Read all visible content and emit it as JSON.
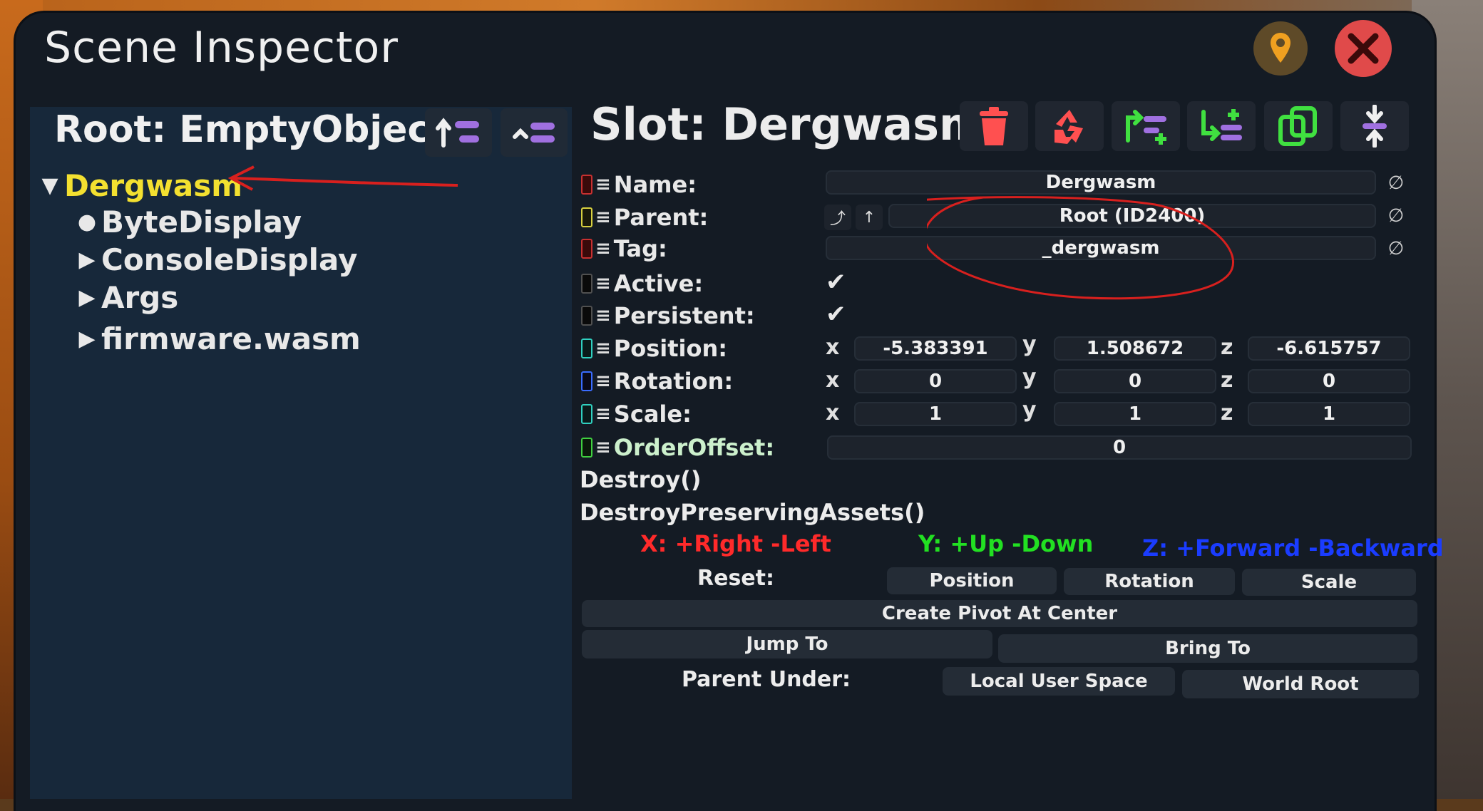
{
  "window": {
    "title": "Scene Inspector"
  },
  "hierarchy": {
    "root_label": "Root: EmptyObject",
    "items": [
      {
        "label": "Dergwasm",
        "expander": "▼",
        "selected": true
      },
      {
        "label": "ByteDisplay",
        "expander": "●"
      },
      {
        "label": "ConsoleDisplay",
        "expander": "▶"
      },
      {
        "label": "Args",
        "expander": "▶"
      },
      {
        "label": "firmware.wasm",
        "expander": "▶"
      }
    ]
  },
  "inspector": {
    "slot_title": "Slot: Dergwasm",
    "fields": {
      "name": {
        "label": "Name:",
        "value": "Dergwasm"
      },
      "parent": {
        "label": "Parent:",
        "value": "Root (ID2400)"
      },
      "tag": {
        "label": "Tag:",
        "value": "_dergwasm"
      },
      "active": {
        "label": "Active:",
        "checked": true
      },
      "persistent": {
        "label": "Persistent:",
        "checked": true
      },
      "position": {
        "label": "Position:",
        "x": "-5.383391",
        "y": "1.508672",
        "z": "-6.615757"
      },
      "rotation": {
        "label": "Rotation:",
        "x": "0",
        "y": "0",
        "z": "0"
      },
      "scale": {
        "label": "Scale:",
        "x": "1",
        "y": "1",
        "z": "1"
      },
      "order_offset": {
        "label": "OrderOffset:",
        "value": "0"
      }
    },
    "axis_letters": {
      "x": "x",
      "y": "y",
      "z": "z"
    },
    "null_symbol": "∅",
    "check_symbol": "✔",
    "methods": [
      "Destroy()",
      "DestroyPreservingAssets()"
    ],
    "axis_hints": {
      "x": "X: +Right -Left",
      "y": "Y: +Up -Down",
      "z": "Z: +Forward -Backward"
    },
    "reset": {
      "label": "Reset:",
      "position": "Position",
      "rotation": "Rotation",
      "scale": "Scale"
    },
    "create_pivot": "Create Pivot At Center",
    "jump_to": "Jump To",
    "bring_to": "Bring To",
    "parent_under": {
      "label": "Parent Under:",
      "local_user_space": "Local User Space",
      "world_root": "World Root"
    }
  },
  "colors": {
    "selected_text": "#f3e030",
    "hint_x": "#ff2a2a",
    "hint_y": "#22e022",
    "hint_z": "#1a3cff",
    "annotation": "#d8201e",
    "label_name": "#c83030",
    "label_parent": "#d8d040",
    "label_position": "#30d0c0",
    "label_rotation": "#3a6cff",
    "label_orderoffset": "#40d040"
  },
  "icons": [
    "map-pin-icon",
    "close-icon",
    "sort-up-icon",
    "sort-down-icon",
    "trash-icon",
    "recycle-icon",
    "insert-parent-icon",
    "insert-child-icon",
    "duplicate-icon",
    "center-icon"
  ]
}
